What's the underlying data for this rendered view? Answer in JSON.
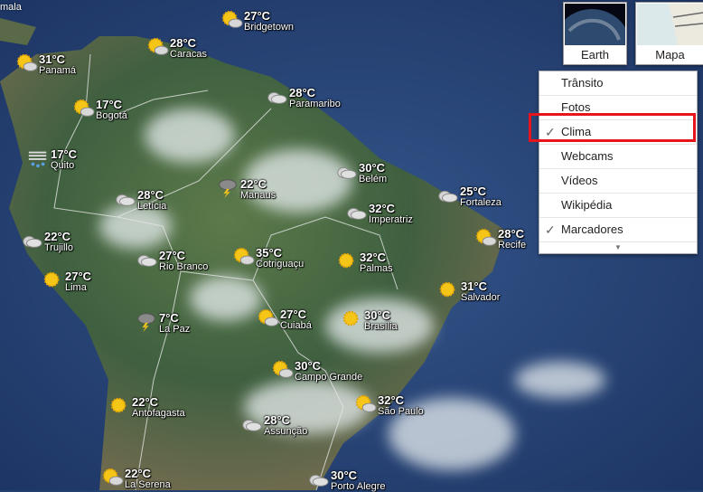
{
  "map_type_buttons": [
    {
      "label": "Earth"
    },
    {
      "label": "Mapa"
    }
  ],
  "layers_menu": {
    "items": [
      {
        "label": "Trânsito",
        "checked": false
      },
      {
        "label": "Fotos",
        "checked": false
      },
      {
        "label": "Clima",
        "checked": true,
        "highlighted": true
      },
      {
        "label": "Webcams",
        "checked": false
      },
      {
        "label": "Vídeos",
        "checked": false
      },
      {
        "label": "Wikipédia",
        "checked": false
      },
      {
        "label": "Marcadores",
        "checked": true
      }
    ],
    "check_glyph": "✓",
    "more_glyph": "▼"
  },
  "highlight_color": "#e8141b",
  "cut_label": "mala",
  "weather": [
    {
      "city": "Bridgetown",
      "temp": "27°C",
      "icon": "partly-cloudy"
    },
    {
      "city": "Caracas",
      "temp": "28°C",
      "icon": "partly-cloudy"
    },
    {
      "city": "Panamá",
      "temp": "31°C",
      "icon": "partly-cloudy"
    },
    {
      "city": "Bogotá",
      "temp": "17°C",
      "icon": "partly-cloudy"
    },
    {
      "city": "Paramaribo",
      "temp": "28°C",
      "icon": "cloudy"
    },
    {
      "city": "Quito",
      "temp": "17°C",
      "icon": "fog-rain"
    },
    {
      "city": "Manaus",
      "temp": "22°C",
      "icon": "thunderstorm"
    },
    {
      "city": "Letícia",
      "temp": "28°C",
      "icon": "cloudy"
    },
    {
      "city": "Belém",
      "temp": "30°C",
      "icon": "cloudy"
    },
    {
      "city": "Imperatriz",
      "temp": "32°C",
      "icon": "cloudy"
    },
    {
      "city": "Fortaleza",
      "temp": "25°C",
      "icon": "cloudy"
    },
    {
      "city": "Trujillo",
      "temp": "22°C",
      "icon": "cloudy"
    },
    {
      "city": "Recife",
      "temp": "28°C",
      "icon": "partly-cloudy"
    },
    {
      "city": "Rio Branco",
      "temp": "27°C",
      "icon": "cloudy"
    },
    {
      "city": "Cotriguaçu",
      "temp": "35°C",
      "icon": "partly-cloudy"
    },
    {
      "city": "Palmas",
      "temp": "32°C",
      "icon": "sunny"
    },
    {
      "city": "Lima",
      "temp": "27°C",
      "icon": "sunny"
    },
    {
      "city": "Salvador",
      "temp": "31°C",
      "icon": "sunny"
    },
    {
      "city": "La Paz",
      "temp": "7°C",
      "icon": "thunderstorm"
    },
    {
      "city": "Cuiabá",
      "temp": "27°C",
      "icon": "partly-cloudy"
    },
    {
      "city": "Brasília",
      "temp": "30°C",
      "icon": "sunny"
    },
    {
      "city": "Campo Grande",
      "temp": "30°C",
      "icon": "partly-cloudy"
    },
    {
      "city": "Antofagasta",
      "temp": "22°C",
      "icon": "sunny"
    },
    {
      "city": "São Paulo",
      "temp": "32°C",
      "icon": "partly-cloudy"
    },
    {
      "city": "Assunção",
      "temp": "28°C",
      "icon": "cloudy"
    },
    {
      "city": "La Serena",
      "temp": "22°C",
      "icon": "partly-cloudy"
    },
    {
      "city": "Porto Alegre",
      "temp": "30°C",
      "icon": "cloudy"
    }
  ]
}
